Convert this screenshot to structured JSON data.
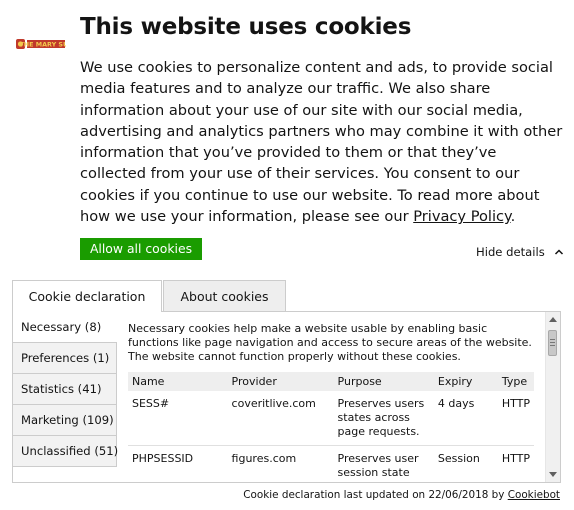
{
  "header": {
    "logo_alt": "THE MARY SUE",
    "title": "This website uses cookies"
  },
  "intro": {
    "text": "We use cookies to personalize content and ads, to provide social media features and to analyze our traffic. We also share information about your use of our site with our social media, advertising and analytics partners who may combine it with other information that you’ve provided to them or that they’ve collected from your use of their services. You consent to our cookies if you continue to use our website. To read more about how we use your information, please see our ",
    "privacy_link": "Privacy Policy",
    "end_period": "."
  },
  "actions": {
    "allow_all": "Allow all cookies",
    "hide_details": "Hide details"
  },
  "tabs": [
    {
      "label": "Cookie declaration",
      "active": true
    },
    {
      "label": "About cookies",
      "active": false
    }
  ],
  "categories": [
    {
      "label": "Necessary (8)",
      "active": true
    },
    {
      "label": "Preferences (1)",
      "active": false
    },
    {
      "label": "Statistics (41)",
      "active": false
    },
    {
      "label": "Marketing (109)",
      "active": false
    },
    {
      "label": "Unclassified (51)",
      "active": false
    }
  ],
  "necessary": {
    "description": "Necessary cookies help make a website usable by enabling basic functions like page navigation and access to secure areas of the website. The website cannot function properly without these cookies.",
    "columns": [
      "Name",
      "Provider",
      "Purpose",
      "Expiry",
      "Type"
    ],
    "rows": [
      {
        "name": "SESS#",
        "provider": "coveritlive.com",
        "purpose": "Preserves users states across page requests.",
        "expiry": "4 days",
        "type": "HTTP"
      },
      {
        "name": "PHPSESSID",
        "provider": "figures.com",
        "purpose": "Preserves user session state",
        "expiry": "Session",
        "type": "HTTP"
      }
    ]
  },
  "footer": {
    "text": "Cookie declaration last updated on 22/06/2018 by ",
    "link": "Cookiebot"
  },
  "colors": {
    "accent_green": "#1a9c00",
    "text": "#141414",
    "border": "#cccccc",
    "logo_red": "#c0392b",
    "logo_gold": "#f2c94c"
  }
}
